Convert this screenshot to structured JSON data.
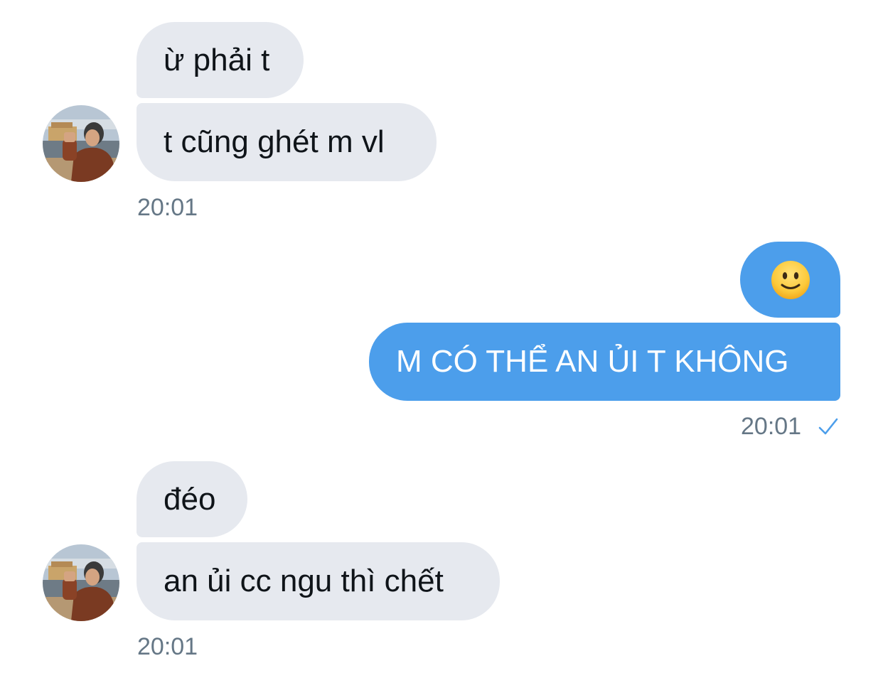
{
  "conversation": {
    "group1": {
      "messages": [
        "ừ phải t",
        "t cũng ghét m vl"
      ],
      "time": "20:01"
    },
    "group2": {
      "emoji": "slightly-smiling-face",
      "messages": [
        "M CÓ THỂ AN ỦI T KHÔNG"
      ],
      "time": "20:01",
      "status": "sent"
    },
    "group3": {
      "messages": [
        "đéo",
        "an ủi cc ngu thì chết"
      ],
      "time": "20:01"
    }
  },
  "colors": {
    "incoming_bubble": "#e6e9ef",
    "outgoing_bubble": "#4c9eeb",
    "timestamp": "#657786",
    "check": "#4c9eeb"
  }
}
